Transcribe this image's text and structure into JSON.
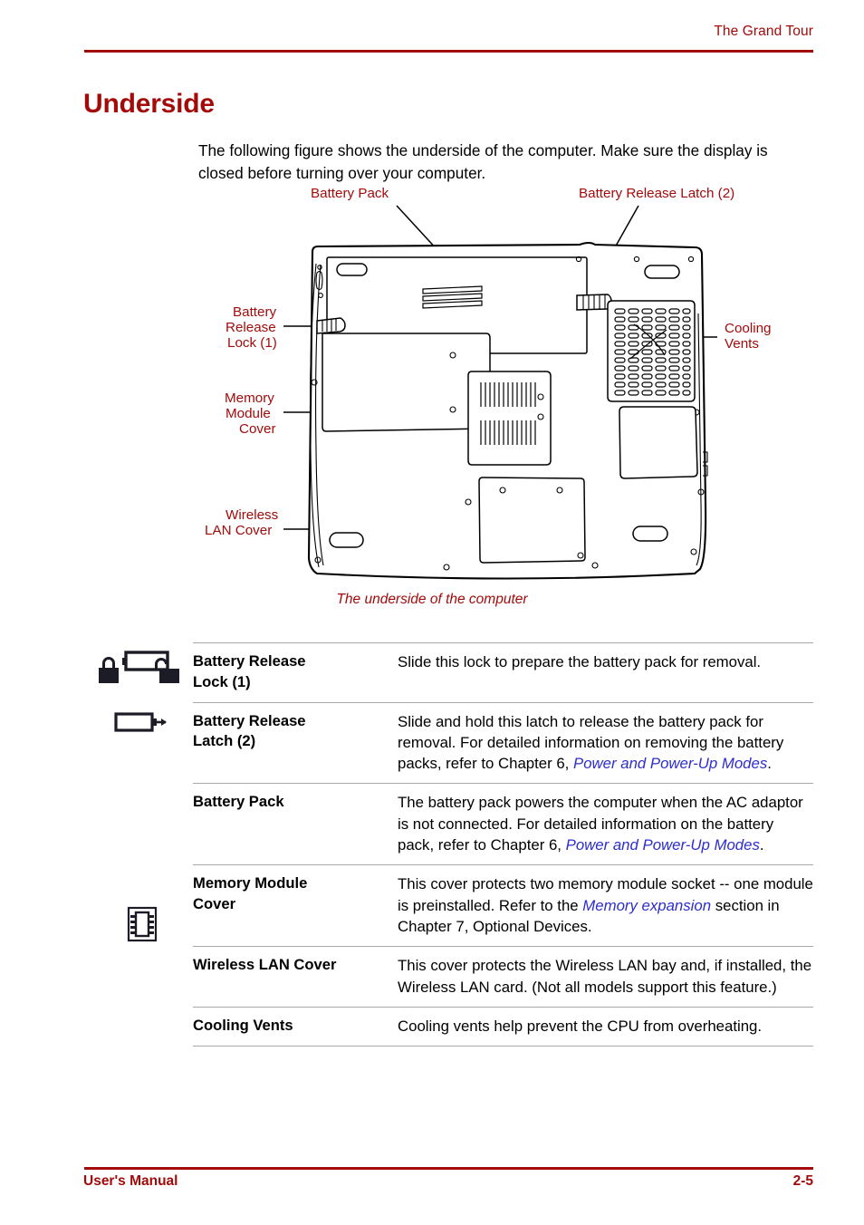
{
  "header": {
    "chapter_title": "The Grand Tour",
    "rule_color": "#a30b0b"
  },
  "section": {
    "title": "Underside",
    "title_color": "#a30b0b"
  },
  "intro": {
    "paragraph": "The following figure shows the underside of the computer. Make sure the display is closed before turning over your computer."
  },
  "figure": {
    "caption": "The underside of the computer",
    "caption_color": "#a30b0b",
    "callouts": {
      "battery_pack": "Battery Pack",
      "battery_release_latch": "Battery Release Latch (2)",
      "cooling_vents_line1": "Cooling",
      "cooling_vents_line2": "Vents",
      "battery_release_lock_line1": "Battery",
      "battery_release_lock_line2": "Release",
      "battery_release_lock_line3": "Lock (1)",
      "memory_module_cover_line1": "Memory",
      "memory_module_cover_line2": "Module",
      "memory_module_cover_line3": "Cover",
      "wireless_lan_cover_line1": "Wireless",
      "wireless_lan_cover_line2": "LAN Cover"
    }
  },
  "spec_table": {
    "rows": [
      {
        "icon": "battery-lock-unlock-icon",
        "term_line1": "Battery Release",
        "term_line2": "Lock (1)",
        "desc_parts": [
          {
            "text": "Slide this lock to prepare the battery pack for removal.",
            "style": "normal"
          }
        ]
      },
      {
        "icon": "battery-eject-icon",
        "term_line1": "Battery Release",
        "term_line2": "Latch (2)",
        "desc_parts": [
          {
            "text": "Slide and hold this latch to release the battery pack for removal. For detailed information on removing the battery packs, refer to Chapter 6, ",
            "style": "normal"
          },
          {
            "text": "Power and Power-Up Modes",
            "style": "ref"
          },
          {
            "text": ".",
            "style": "normal"
          }
        ]
      },
      {
        "icon": "",
        "term_line1": "Battery Pack",
        "term_line2": "",
        "desc_parts": [
          {
            "text": "The battery pack powers the computer when the AC adaptor is not connected. For detailed information on the battery pack, refer to Chapter 6, ",
            "style": "normal"
          },
          {
            "text": "Power and Power-Up Modes",
            "style": "ref"
          },
          {
            "text": ".",
            "style": "normal"
          }
        ]
      },
      {
        "icon": "memory-chip-icon",
        "term_line1": "Memory Module",
        "term_line2": "Cover",
        "desc_parts": [
          {
            "text": "This cover protects two memory module socket -- one module is preinstalled. Refer to the ",
            "style": "normal"
          },
          {
            "text": "Memory expansion",
            "style": "ref"
          },
          {
            "text": " section in Chapter 7, Optional Devices.",
            "style": "normal"
          }
        ]
      },
      {
        "icon": "",
        "term_line1": "Wireless LAN Cover",
        "term_line2": "",
        "desc_parts": [
          {
            "text": "This cover protects the Wireless LAN bay and, if installed, the Wireless LAN card. (Not all models support this feature.)",
            "style": "normal"
          }
        ]
      },
      {
        "icon": "",
        "term_line1": "Cooling Vents",
        "term_line2": "",
        "desc_parts": [
          {
            "text": "Cooling vents help prevent the CPU from overheating.",
            "style": "normal"
          }
        ]
      }
    ],
    "ref_color": "#2d2dcf",
    "rule_color": "#a8a8a8"
  },
  "footer": {
    "manual_label": "User's Manual",
    "page_number": "2-5",
    "color": "#a30b0b"
  }
}
